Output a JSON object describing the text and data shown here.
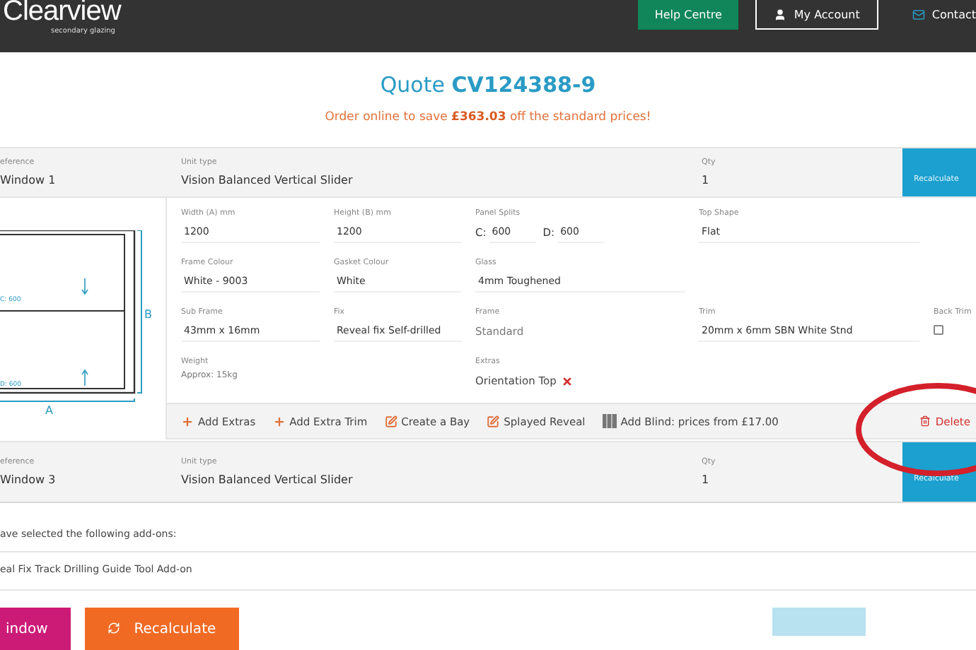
{
  "header": {
    "logo": "Clearview",
    "tagline": "secondary glazing",
    "nav": [
      {
        "label": "Help Centre",
        "kind": "primary"
      },
      {
        "label": "My Account",
        "kind": "outline"
      },
      {
        "label": "Contact",
        "kind": "link"
      }
    ]
  },
  "quote": {
    "title": "Quote",
    "number": "CV124388-9",
    "savings": "Order online to save **£363.03** off the standard prices!"
  },
  "windows": [
    {
      "reference_label": "eference",
      "reference": "Window 1",
      "unit_label": "Unit type",
      "unit": "Vision Balanced Vertical Slider",
      "qty_label": "Qty",
      "qty": "1",
      "recalc": "Recalculate",
      "expanded": true
    },
    {
      "reference_label": "eference",
      "reference": "Window 3",
      "unit_label": "Unit type",
      "unit": "Vision Balanced Vertical Slider",
      "qty_label": "Qty",
      "qty": "1",
      "recalc": "Recalculate",
      "expanded": false
    }
  ],
  "drawing": {
    "width_label": "A",
    "height_label": "B",
    "upper_split": "C: 600",
    "lower_split": "D: 600"
  },
  "field_rows": [
    [
      {
        "kind": "input",
        "label": "Width (A) mm",
        "value": "1200"
      },
      {
        "kind": "input",
        "label": "Height (B) mm",
        "value": "1200"
      },
      {
        "kind": "splits",
        "label": "Panel Splits",
        "parts": [
          {
            "name": "C:",
            "value": "600"
          },
          {
            "name": "D:",
            "value": "600"
          }
        ]
      },
      {
        "kind": "input",
        "label": "Top Shape",
        "value": "Flat"
      }
    ],
    [
      {
        "kind": "input",
        "label": "Frame Colour",
        "value": "White - 9003"
      },
      {
        "kind": "input",
        "label": "Gasket Colour",
        "value": "White"
      },
      {
        "kind": "input",
        "label": "Glass",
        "value": "4mm Toughened"
      }
    ],
    [
      {
        "kind": "input",
        "label": "Sub Frame",
        "value": "43mm x 16mm"
      },
      {
        "kind": "input",
        "label": "Fix",
        "value": "Reveal fix Self-drilled"
      },
      {
        "kind": "plain",
        "label": "Frame",
        "value": "Standard"
      },
      {
        "kind": "input",
        "label": "Trim",
        "value": "20mm x 6mm SBN White Stnd"
      },
      {
        "kind": "check",
        "label": "Back Trim",
        "checked": false
      }
    ],
    [
      {
        "kind": "note",
        "label": "Weight",
        "value": "Approx: 15kg"
      },
      {
        "kind": "blank"
      },
      {
        "kind": "extra",
        "label": "Extras",
        "value": "Orientation Top"
      }
    ]
  ],
  "actions": [
    {
      "kind": "plus",
      "label": "Add Extras"
    },
    {
      "kind": "plus",
      "label": "Add Extra Trim"
    },
    {
      "kind": "edit",
      "label": "Create a Bay"
    },
    {
      "kind": "edit",
      "label": "Splayed Reveal"
    },
    {
      "kind": "blind",
      "label": "Add Blind: prices from £17.00"
    }
  ],
  "delete": "Delete",
  "addons": {
    "intro": "ave selected the following add-ons:",
    "items": [
      "eal Fix Track Drilling Guide Tool Add-on"
    ]
  },
  "footer_buttons": [
    {
      "kind": "pink",
      "label": "indow"
    },
    {
      "kind": "orange",
      "label": "Recalculate"
    }
  ]
}
